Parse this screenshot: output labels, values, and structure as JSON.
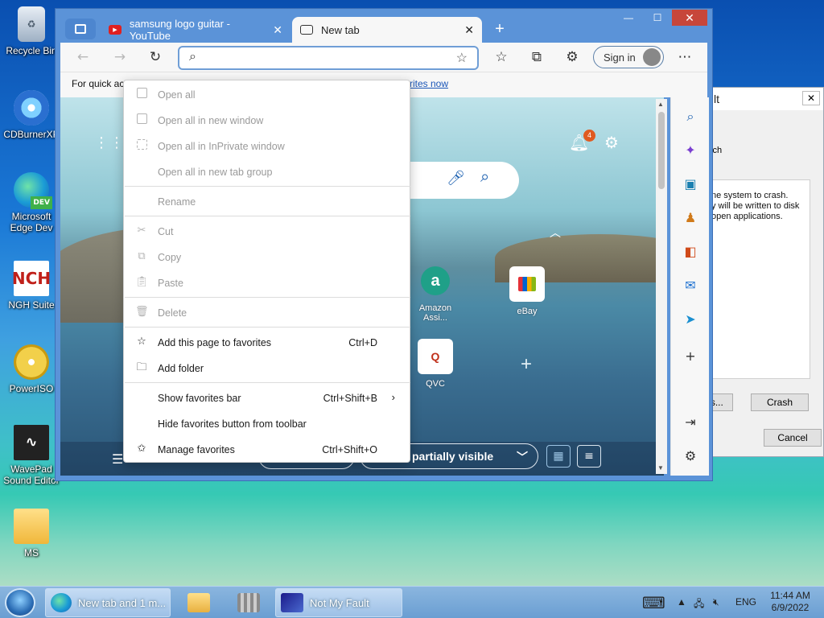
{
  "desktop": {
    "icons": [
      {
        "label": "Recycle Bin",
        "icon": "recycle-bin-icon"
      },
      {
        "label": "CDBurnerXP",
        "icon": "cdburnerxp-icon"
      },
      {
        "label": "Microsoft Edge Dev",
        "icon": "edge-dev-icon",
        "badge": "DEV"
      },
      {
        "label": "NGH Suite",
        "icon": "nch-suite-icon",
        "glyph": "NCH"
      },
      {
        "label": "PowerISO",
        "icon": "poweriso-icon"
      },
      {
        "label": "WavePad Sound Editor",
        "icon": "wavepad-icon"
      },
      {
        "label": "MS",
        "icon": "folder-icon"
      }
    ]
  },
  "background_dialog": {
    "title_fragment": "lt",
    "text_fragment": "ich",
    "panel_text": "ne system to crash.\ny will be written to disk\nopen applications.",
    "buttons": {
      "options_fragment": "ors...",
      "crash": "Crash",
      "cancel": "Cancel"
    }
  },
  "browser": {
    "tabs": [
      {
        "title": "samsung logo guitar - YouTube",
        "favicon": "youtube-icon",
        "active": false
      },
      {
        "title": "New tab",
        "favicon": "new-tab-icon",
        "active": true
      }
    ],
    "address": {
      "value": "",
      "placeholder": ""
    },
    "signin_label": "Sign in",
    "favorites_bar": {
      "text": "For quick ac",
      "link_text": "rites now"
    },
    "ntp": {
      "notification_count": "4",
      "tiles": [
        {
          "label": "Amazon Assi...",
          "icon": "amazon-assistant-icon",
          "glyph": "a"
        },
        {
          "label": "eBay",
          "icon": "ebay-icon"
        },
        {
          "label": "QVC",
          "icon": "qvc-icon",
          "glyph": "Q"
        }
      ],
      "feed_visibility": "partially visible"
    }
  },
  "context_menu": {
    "items": [
      {
        "label": "Open all",
        "shortcut": "",
        "disabled": true,
        "icon": "box-icon"
      },
      {
        "label": "Open all in new window",
        "shortcut": "",
        "disabled": true,
        "icon": "window-icon"
      },
      {
        "label": "Open all in InPrivate window",
        "shortcut": "",
        "disabled": true,
        "icon": "inprivate-icon"
      },
      {
        "label": "Open all in new tab group",
        "shortcut": "",
        "disabled": true,
        "icon": ""
      },
      {
        "label": "Rename",
        "shortcut": "",
        "disabled": true,
        "icon": ""
      },
      {
        "label": "Cut",
        "shortcut": "",
        "disabled": true,
        "icon": "scissors-icon"
      },
      {
        "label": "Copy",
        "shortcut": "",
        "disabled": true,
        "icon": "copy-icon"
      },
      {
        "label": "Paste",
        "shortcut": "",
        "disabled": true,
        "icon": "paste-icon"
      },
      {
        "label": "Delete",
        "shortcut": "",
        "disabled": true,
        "icon": "trash-icon"
      },
      {
        "label": "Add this page to favorites",
        "shortcut": "Ctrl+D",
        "disabled": false,
        "icon": "star-add-icon"
      },
      {
        "label": "Add folder",
        "shortcut": "",
        "disabled": false,
        "icon": "folder-add-icon"
      },
      {
        "label": "Show favorites bar",
        "shortcut": "Ctrl+Shift+B",
        "disabled": false,
        "icon": "",
        "submenu": true
      },
      {
        "label": "Hide favorites button from toolbar",
        "shortcut": "",
        "disabled": false,
        "icon": ""
      },
      {
        "label": "Manage favorites",
        "shortcut": "Ctrl+Shift+O",
        "disabled": false,
        "icon": "star-gear-icon"
      }
    ]
  },
  "taskbar": {
    "buttons": [
      {
        "label": "New tab and 1 m...",
        "icon": "edge-dev-icon"
      },
      {
        "label": "",
        "icon": "file-explorer-icon"
      },
      {
        "label": "",
        "icon": "app-grid-icon"
      },
      {
        "label": "Not My Fault",
        "icon": "not-my-fault-icon"
      }
    ],
    "language": "ENG",
    "time": "11:44 AM",
    "date": "6/9/2022"
  }
}
